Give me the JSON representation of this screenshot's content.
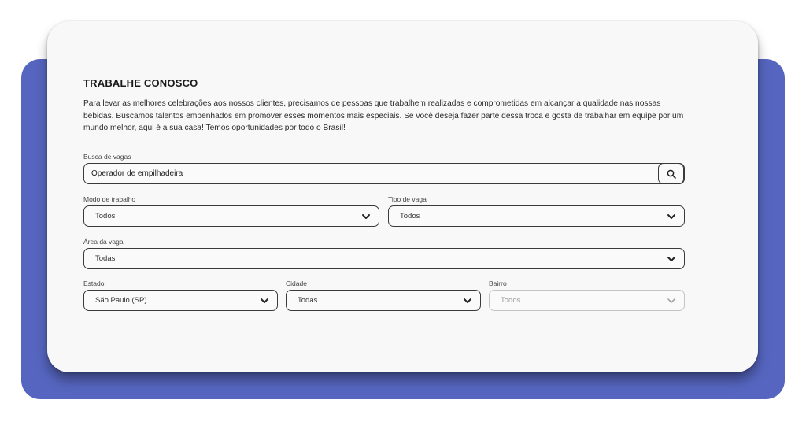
{
  "section": {
    "title": "TRABALHE CONOSCO",
    "description": "Para levar as melhores celebrações aos nossos clientes, precisamos de pessoas que trabalhem realizadas e comprometidas em alcançar a qualidade nas nossas bebidas. Buscamos talentos empenhados em promover esses momentos mais especiais. Se você deseja fazer parte dessa troca e gosta de trabalhar em equipe por um mundo melhor, aqui é a sua casa! Temos oportunidades por todo o Brasil!"
  },
  "search": {
    "label": "Busca de vagas",
    "value": "Operador de empilhadeira",
    "icon": "search-icon"
  },
  "filters": {
    "modo": {
      "label": "Modo de trabalho",
      "value": "Todos"
    },
    "tipo": {
      "label": "Tipo de vaga",
      "value": "Todos"
    },
    "area": {
      "label": "Área da vaga",
      "value": "Todas"
    },
    "estado": {
      "label": "Estado",
      "value": "São Paulo (SP)"
    },
    "cidade": {
      "label": "Cidade",
      "value": "Todas"
    },
    "bairro": {
      "label": "Bairro",
      "value": "Todos",
      "disabled": true
    }
  },
  "colors": {
    "backdrop": "#5665bf",
    "card": "#f8f8f8",
    "border": "#3a3a3a",
    "disabled_border": "#c4c4c4"
  }
}
